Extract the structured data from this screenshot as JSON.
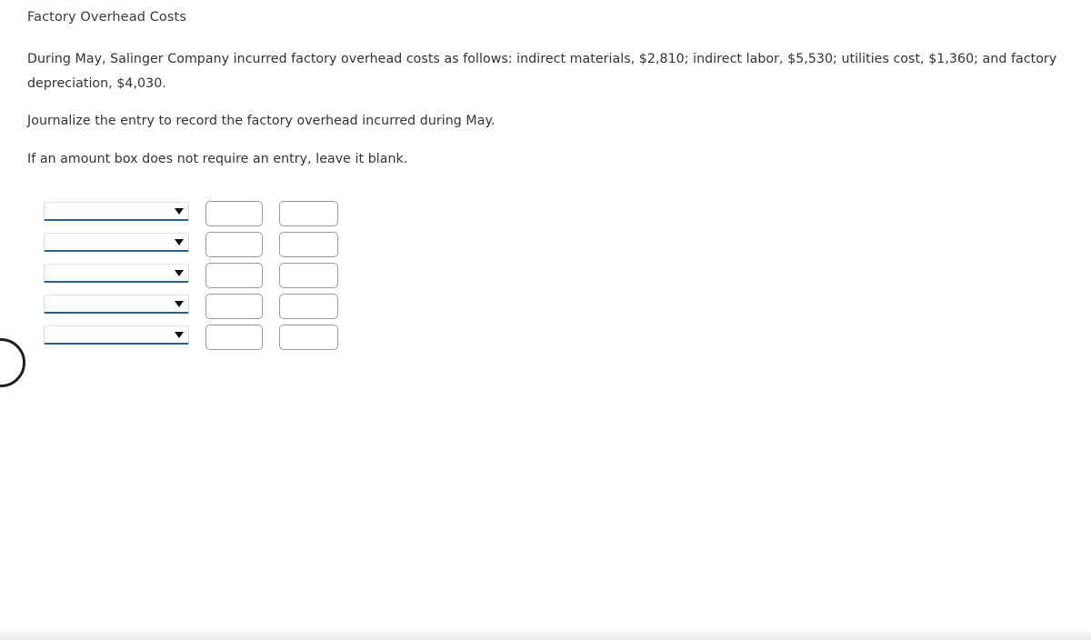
{
  "question": {
    "title": "Factory Overhead Costs",
    "paragraphs": [
      "During May, Salinger Company incurred factory overhead costs as follows: indirect materials, $2,810; indirect labor, $5,530; utilities cost, $1,360; and factory depreciation, $4,030.",
      "Journalize the entry to record the factory overhead incurred during May.",
      "If an amount box does not require an entry, leave it blank."
    ]
  },
  "journal_entry": {
    "rows": [
      {
        "account": "",
        "debit": "",
        "credit": ""
      },
      {
        "account": "",
        "debit": "",
        "credit": ""
      },
      {
        "account": "",
        "debit": "",
        "credit": ""
      },
      {
        "account": "",
        "debit": "",
        "credit": ""
      },
      {
        "account": "",
        "debit": "",
        "credit": ""
      }
    ]
  },
  "colors": {
    "select_underline": "#2d5c86",
    "input_border": "#9a9a9a",
    "text": "#333333",
    "caret": "#111111"
  }
}
